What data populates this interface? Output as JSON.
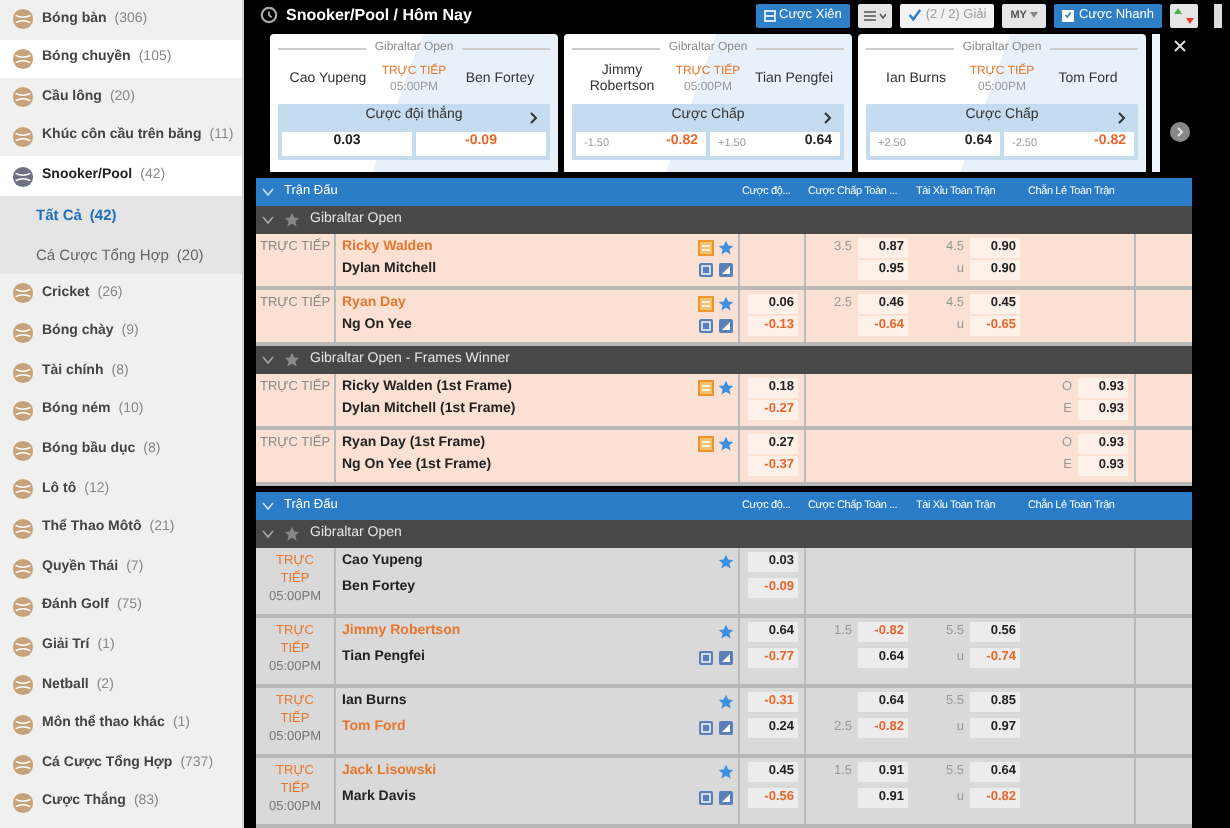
{
  "sidebar": {
    "items": [
      {
        "label": "Bóng bàn",
        "count": "(306)",
        "selected": false,
        "highlighted": false
      },
      {
        "label": "Bóng chuyền",
        "count": "(105)",
        "selected": false,
        "highlighted": true
      },
      {
        "label": "Cầu lông",
        "count": "(20)",
        "selected": false,
        "highlighted": false
      },
      {
        "label": "Khúc côn cầu trên băng",
        "count": "(11)",
        "selected": false,
        "highlighted": false
      },
      {
        "label": "Snooker/Pool",
        "count": "(42)",
        "selected": true,
        "highlighted": true,
        "children": [
          {
            "label": "Tất Cả",
            "count": "(42)",
            "selected": true
          },
          {
            "label": "Cá Cược Tổng Hợp",
            "count": "(20)",
            "selected": false
          }
        ]
      },
      {
        "label": "Cricket",
        "count": "(26)",
        "selected": false,
        "highlighted": false
      },
      {
        "label": "Bóng chày",
        "count": "(9)",
        "selected": false,
        "highlighted": false
      },
      {
        "label": "Tài chính",
        "count": "(8)",
        "selected": false,
        "highlighted": false
      },
      {
        "label": "Bóng ném",
        "count": "(10)",
        "selected": false,
        "highlighted": false
      },
      {
        "label": "Bóng bầu dục",
        "count": "(8)",
        "selected": false,
        "highlighted": false
      },
      {
        "label": "Lô tô",
        "count": "(12)",
        "selected": false,
        "highlighted": false
      },
      {
        "label": "Thể Thao Môtô",
        "count": "(21)",
        "selected": false,
        "highlighted": false
      },
      {
        "label": "Quyền Thái",
        "count": "(7)",
        "selected": false,
        "highlighted": false
      },
      {
        "label": "Đánh Golf",
        "count": "(75)",
        "selected": false,
        "highlighted": false
      },
      {
        "label": "Giải Trí",
        "count": "(1)",
        "selected": false,
        "highlighted": false
      },
      {
        "label": "Netball",
        "count": "(2)",
        "selected": false,
        "highlighted": false
      },
      {
        "label": "Môn thể thao khác",
        "count": "(1)",
        "selected": false,
        "highlighted": false
      },
      {
        "label": "Cá Cược Tổng Hợp",
        "count": "(737)",
        "selected": false,
        "highlighted": false
      },
      {
        "label": "Cược Thắng",
        "count": "(83)",
        "selected": false,
        "highlighted": false
      }
    ]
  },
  "header": {
    "title": "Snooker/Pool / Hôm Nay",
    "parlay_button": "Cược Xiên",
    "leagues_button": "(2 / 2) Giải",
    "view_button": "MY",
    "quick_bet": {
      "label": "Cược Nhanh",
      "checked": true
    }
  },
  "cards": [
    {
      "league": "Gibraltar Open",
      "home": "Cao Yupeng",
      "away": "Ben Fortey",
      "status": "TRỰC TIẾP",
      "time": "05:00PM",
      "market": "Cược đội thắng",
      "odds": [
        {
          "value": "0.03",
          "negative": false
        },
        {
          "value": "-0.09",
          "negative": true
        }
      ]
    },
    {
      "league": "Gibraltar Open",
      "home": "Jimmy Robertson",
      "away": "Tian Pengfei",
      "status": "TRỰC TIẾP",
      "time": "05:00PM",
      "market": "Cược Chấp",
      "odds": [
        {
          "label": "-1.50",
          "value": "-0.82",
          "negative": true
        },
        {
          "label": "+1.50",
          "value": "0.64",
          "negative": false
        }
      ]
    },
    {
      "league": "Gibraltar Open",
      "home": "Ian Burns",
      "away": "Tom Ford",
      "status": "TRỰC TIẾP",
      "time": "05:00PM",
      "market": "Cược Chấp",
      "odds": [
        {
          "label": "+2.50",
          "value": "0.64",
          "negative": false
        },
        {
          "label": "-2.50",
          "value": "-0.82",
          "negative": true
        }
      ]
    }
  ],
  "tables": [
    {
      "kind": "featured",
      "columns": [
        "Trận Đấu",
        "Cược độ...",
        "Cược Chấp Toàn ...",
        "Tài Xỉu Toàn Trận",
        "Chẵn Lẻ Toàn Trận"
      ],
      "groups": [
        {
          "name": "Gibraltar Open",
          "matches": [
            {
              "status": "TRỰC TIẾP",
              "stats_badge": true,
              "media_icons": true,
              "teams": [
                {
                  "name": "Ricky Walden",
                  "highlighted": true
                },
                {
                  "name": "Dylan Mitchell",
                  "highlighted": false
                }
              ],
              "markets": {
                "handicap": [
                  {
                    "label": "3.5",
                    "value": "0.87",
                    "negative": false
                  },
                  {
                    "value": "0.95",
                    "negative": false
                  }
                ],
                "total": [
                  {
                    "label": "4.5",
                    "value": "0.90",
                    "negative": false
                  },
                  {
                    "label": "u",
                    "value": "0.90",
                    "negative": false
                  }
                ]
              }
            },
            {
              "status": "TRỰC TIẾP",
              "stats_badge": true,
              "media_icons": true,
              "teams": [
                {
                  "name": "Ryan Day",
                  "highlighted": true
                },
                {
                  "name": "Ng On Yee",
                  "highlighted": false
                }
              ],
              "markets": {
                "winner": [
                  {
                    "value": "0.06",
                    "negative": false
                  },
                  {
                    "value": "-0.13",
                    "negative": true
                  }
                ],
                "handicap": [
                  {
                    "label": "2.5",
                    "value": "0.46",
                    "negative": false
                  },
                  {
                    "value": "-0.64",
                    "negative": true
                  }
                ],
                "total": [
                  {
                    "label": "4.5",
                    "value": "0.45",
                    "negative": false
                  },
                  {
                    "label": "u",
                    "value": "-0.65",
                    "negative": true
                  }
                ]
              }
            }
          ]
        },
        {
          "name": "Gibraltar Open - Frames Winner",
          "matches": [
            {
              "status": "TRỰC TIẾP",
              "stats_badge": true,
              "media_icons": false,
              "teams": [
                {
                  "name": "Ricky Walden (1st Frame)",
                  "highlighted": false
                },
                {
                  "name": "Dylan Mitchell (1st Frame)",
                  "highlighted": false
                }
              ],
              "markets": {
                "winner": [
                  {
                    "value": "0.18",
                    "negative": false
                  },
                  {
                    "value": "-0.27",
                    "negative": true
                  }
                ],
                "odd_even": [
                  {
                    "label": "O",
                    "value": "0.93",
                    "negative": false
                  },
                  {
                    "label": "E",
                    "value": "0.93",
                    "negative": false
                  }
                ]
              }
            },
            {
              "status": "TRỰC TIẾP",
              "stats_badge": true,
              "media_icons": false,
              "teams": [
                {
                  "name": "Ryan Day (1st Frame)",
                  "highlighted": false
                },
                {
                  "name": "Ng On Yee (1st Frame)",
                  "highlighted": false
                }
              ],
              "markets": {
                "winner": [
                  {
                    "value": "0.27",
                    "negative": false
                  },
                  {
                    "value": "-0.37",
                    "negative": true
                  }
                ],
                "odd_even": [
                  {
                    "label": "O",
                    "value": "0.93",
                    "negative": false
                  },
                  {
                    "label": "E",
                    "value": "0.93",
                    "negative": false
                  }
                ]
              }
            }
          ]
        }
      ]
    },
    {
      "kind": "standard",
      "columns": [
        "Trận Đấu",
        "Cược độ...",
        "Cược Chấp Toàn ...",
        "Tài Xỉu Toàn Trận",
        "Chẵn Lẻ Toàn Trận"
      ],
      "groups": [
        {
          "name": "Gibraltar Open",
          "matches": [
            {
              "status": "TRỰC TIẾP",
              "time": "05:00PM",
              "stats_badge": false,
              "media_icons": false,
              "teams": [
                {
                  "name": "Cao Yupeng",
                  "highlighted": false
                },
                {
                  "name": "Ben Fortey",
                  "highlighted": false
                }
              ],
              "markets": {
                "winner": [
                  {
                    "value": "0.03",
                    "negative": false
                  },
                  {
                    "value": "-0.09",
                    "negative": true
                  }
                ]
              }
            },
            {
              "status": "TRỰC TIẾP",
              "time": "05:00PM",
              "stats_badge": false,
              "media_icons": true,
              "teams": [
                {
                  "name": "Jimmy Robertson",
                  "highlighted": true
                },
                {
                  "name": "Tian Pengfei",
                  "highlighted": false
                }
              ],
              "markets": {
                "winner": [
                  {
                    "value": "0.64",
                    "negative": false
                  },
                  {
                    "value": "-0.77",
                    "negative": true
                  }
                ],
                "handicap": [
                  {
                    "label": "1.5",
                    "value": "-0.82",
                    "negative": true
                  },
                  {
                    "value": "0.64",
                    "negative": false
                  }
                ],
                "total": [
                  {
                    "label": "5.5",
                    "value": "0.56",
                    "negative": false
                  },
                  {
                    "label": "u",
                    "value": "-0.74",
                    "negative": true
                  }
                ]
              }
            },
            {
              "status": "TRỰC TIẾP",
              "time": "05:00PM",
              "stats_badge": false,
              "media_icons": true,
              "teams": [
                {
                  "name": "Ian Burns",
                  "highlighted": false
                },
                {
                  "name": "Tom Ford",
                  "highlighted": true
                }
              ],
              "markets": {
                "winner": [
                  {
                    "value": "-0.31",
                    "negative": true
                  },
                  {
                    "value": "0.24",
                    "negative": false
                  }
                ],
                "handicap": [
                  {
                    "value": "0.64",
                    "negative": false
                  },
                  {
                    "label": "2.5",
                    "value": "-0.82",
                    "negative": true
                  }
                ],
                "total": [
                  {
                    "label": "5.5",
                    "value": "0.85",
                    "negative": false
                  },
                  {
                    "label": "u",
                    "value": "0.97",
                    "negative": false
                  }
                ]
              }
            },
            {
              "status": "TRỰC TIẾP",
              "time": "05:00PM",
              "stats_badge": false,
              "media_icons": true,
              "teams": [
                {
                  "name": "Jack Lisowski",
                  "highlighted": true
                },
                {
                  "name": "Mark Davis",
                  "highlighted": false
                }
              ],
              "markets": {
                "winner": [
                  {
                    "value": "0.45",
                    "negative": false
                  },
                  {
                    "value": "-0.56",
                    "negative": true
                  }
                ],
                "handicap": [
                  {
                    "label": "1.5",
                    "value": "0.91",
                    "negative": false
                  },
                  {
                    "value": "0.91",
                    "negative": false
                  }
                ],
                "total": [
                  {
                    "label": "5.5",
                    "value": "0.64",
                    "negative": false
                  },
                  {
                    "label": "u",
                    "value": "-0.82",
                    "negative": true
                  }
                ]
              }
            }
          ]
        }
      ]
    }
  ]
}
